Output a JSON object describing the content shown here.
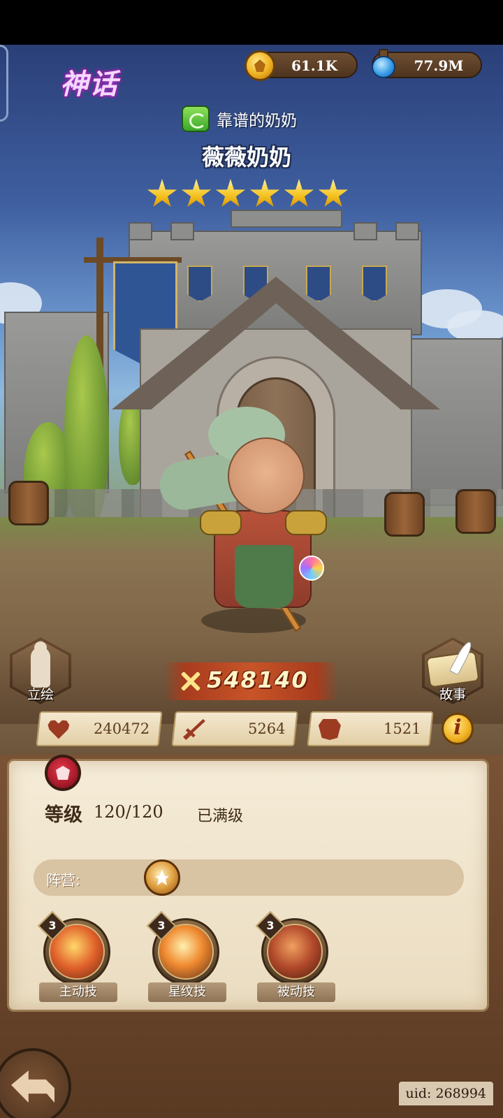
{
  "header": {
    "rarity": "神话",
    "gold": "61.1K",
    "potion": "77.9M"
  },
  "hero": {
    "class_name": "靠谱的奶奶",
    "name": "薇薇奶奶",
    "stars": 6,
    "power": "548140"
  },
  "side_buttons": {
    "portrait": "立绘",
    "story": "故事"
  },
  "stats": {
    "hp": "240472",
    "attack": "5264",
    "defense": "1521"
  },
  "panel": {
    "level_label": "等级",
    "level_value": "120/120",
    "level_status": "已满级",
    "camp_label": "阵营:",
    "skills": [
      {
        "level": "3",
        "label": "主动技"
      },
      {
        "level": "3",
        "label": "星纹技"
      },
      {
        "level": "3",
        "label": "被动技"
      }
    ]
  },
  "footer": {
    "uid": "uid: 268994"
  }
}
